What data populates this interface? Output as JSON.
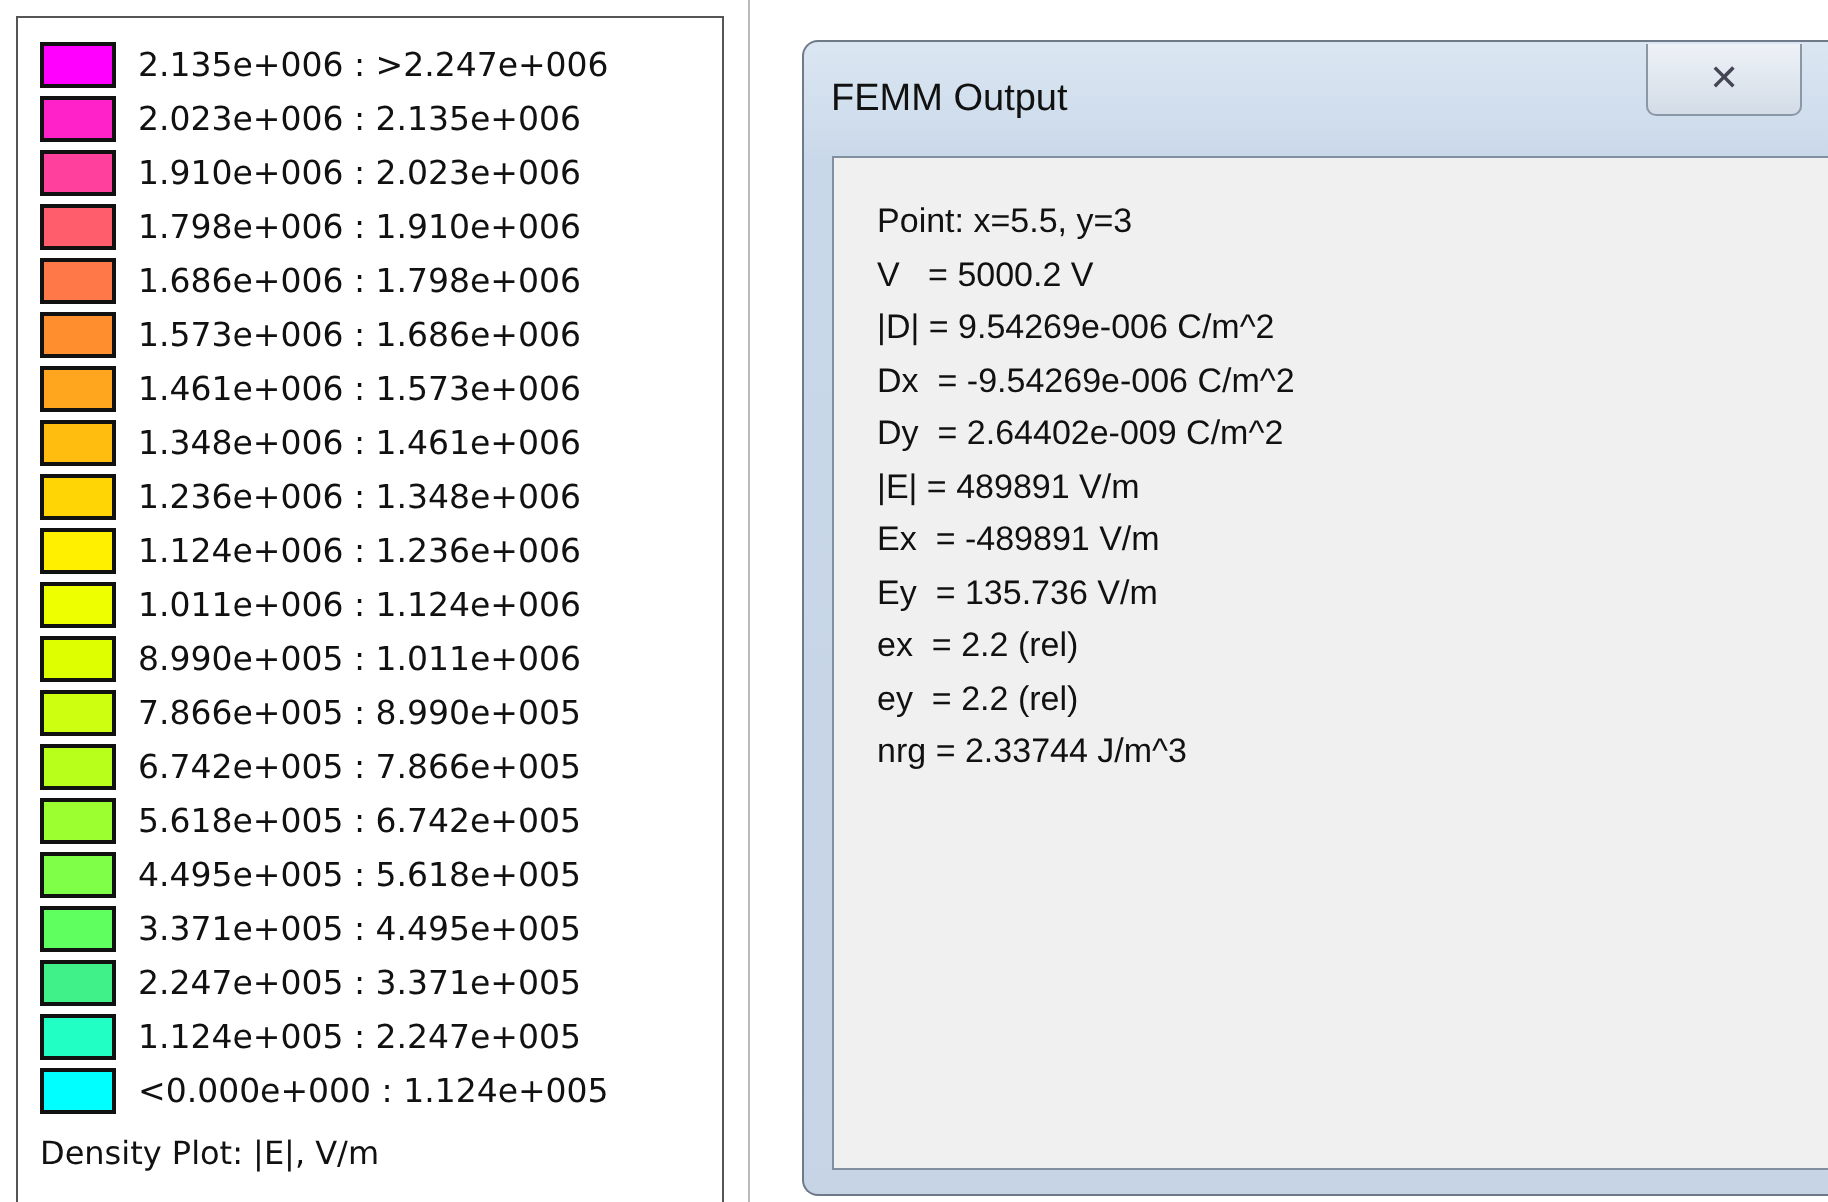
{
  "legend": {
    "rows": [
      {
        "range": "2.135e+006 : >2.247e+006",
        "color": "#ff00ff"
      },
      {
        "range": "2.023e+006 : 2.135e+006",
        "color": "#ff22c8"
      },
      {
        "range": "1.910e+006 : 2.023e+006",
        "color": "#ff409c"
      },
      {
        "range": "1.798e+006 : 1.910e+006",
        "color": "#ff5c6c"
      },
      {
        "range": "1.686e+006 : 1.798e+006",
        "color": "#ff7848"
      },
      {
        "range": "1.573e+006 : 1.686e+006",
        "color": "#ff8f2e"
      },
      {
        "range": "1.461e+006 : 1.573e+006",
        "color": "#ffa61e"
      },
      {
        "range": "1.348e+006 : 1.461e+006",
        "color": "#ffbd10"
      },
      {
        "range": "1.236e+006 : 1.348e+006",
        "color": "#ffd506"
      },
      {
        "range": "1.124e+006 : 1.236e+006",
        "color": "#fff000"
      },
      {
        "range": "1.011e+006 : 1.124e+006",
        "color": "#eeff00"
      },
      {
        "range": "8.990e+005 : 1.011e+006",
        "color": "#ddff00"
      },
      {
        "range": "7.866e+005 : 8.990e+005",
        "color": "#ccff10"
      },
      {
        "range": "6.742e+005 : 7.866e+005",
        "color": "#b8ff1c"
      },
      {
        "range": "5.618e+005 : 6.742e+005",
        "color": "#9cff30"
      },
      {
        "range": "4.495e+005 : 5.618e+005",
        "color": "#80ff48"
      },
      {
        "range": "3.371e+005 : 4.495e+005",
        "color": "#60ff60"
      },
      {
        "range": "2.247e+005 : 3.371e+005",
        "color": "#40f088"
      },
      {
        "range": "1.124e+005 : 2.247e+005",
        "color": "#22ffc4"
      },
      {
        "range": "<0.000e+000 : 1.124e+005",
        "color": "#00ffff"
      }
    ],
    "caption": "Density Plot: |E|, V/m"
  },
  "window": {
    "title": "FEMM Output",
    "close": "✕",
    "lines": [
      "Point: x=5.5, y=3",
      "V   = 5000.2 V",
      "|D| = 9.54269e-006 C/m^2",
      "Dx  = -9.54269e-006 C/m^2",
      "Dy  = 2.64402e-009 C/m^2",
      "|E| = 489891 V/m",
      "Ex  = -489891 V/m",
      "Ey  = 135.736 V/m",
      "ex  = 2.2 (rel)",
      "ey  = 2.2 (rel)",
      "nrg = 2.33744 J/m^3"
    ]
  }
}
